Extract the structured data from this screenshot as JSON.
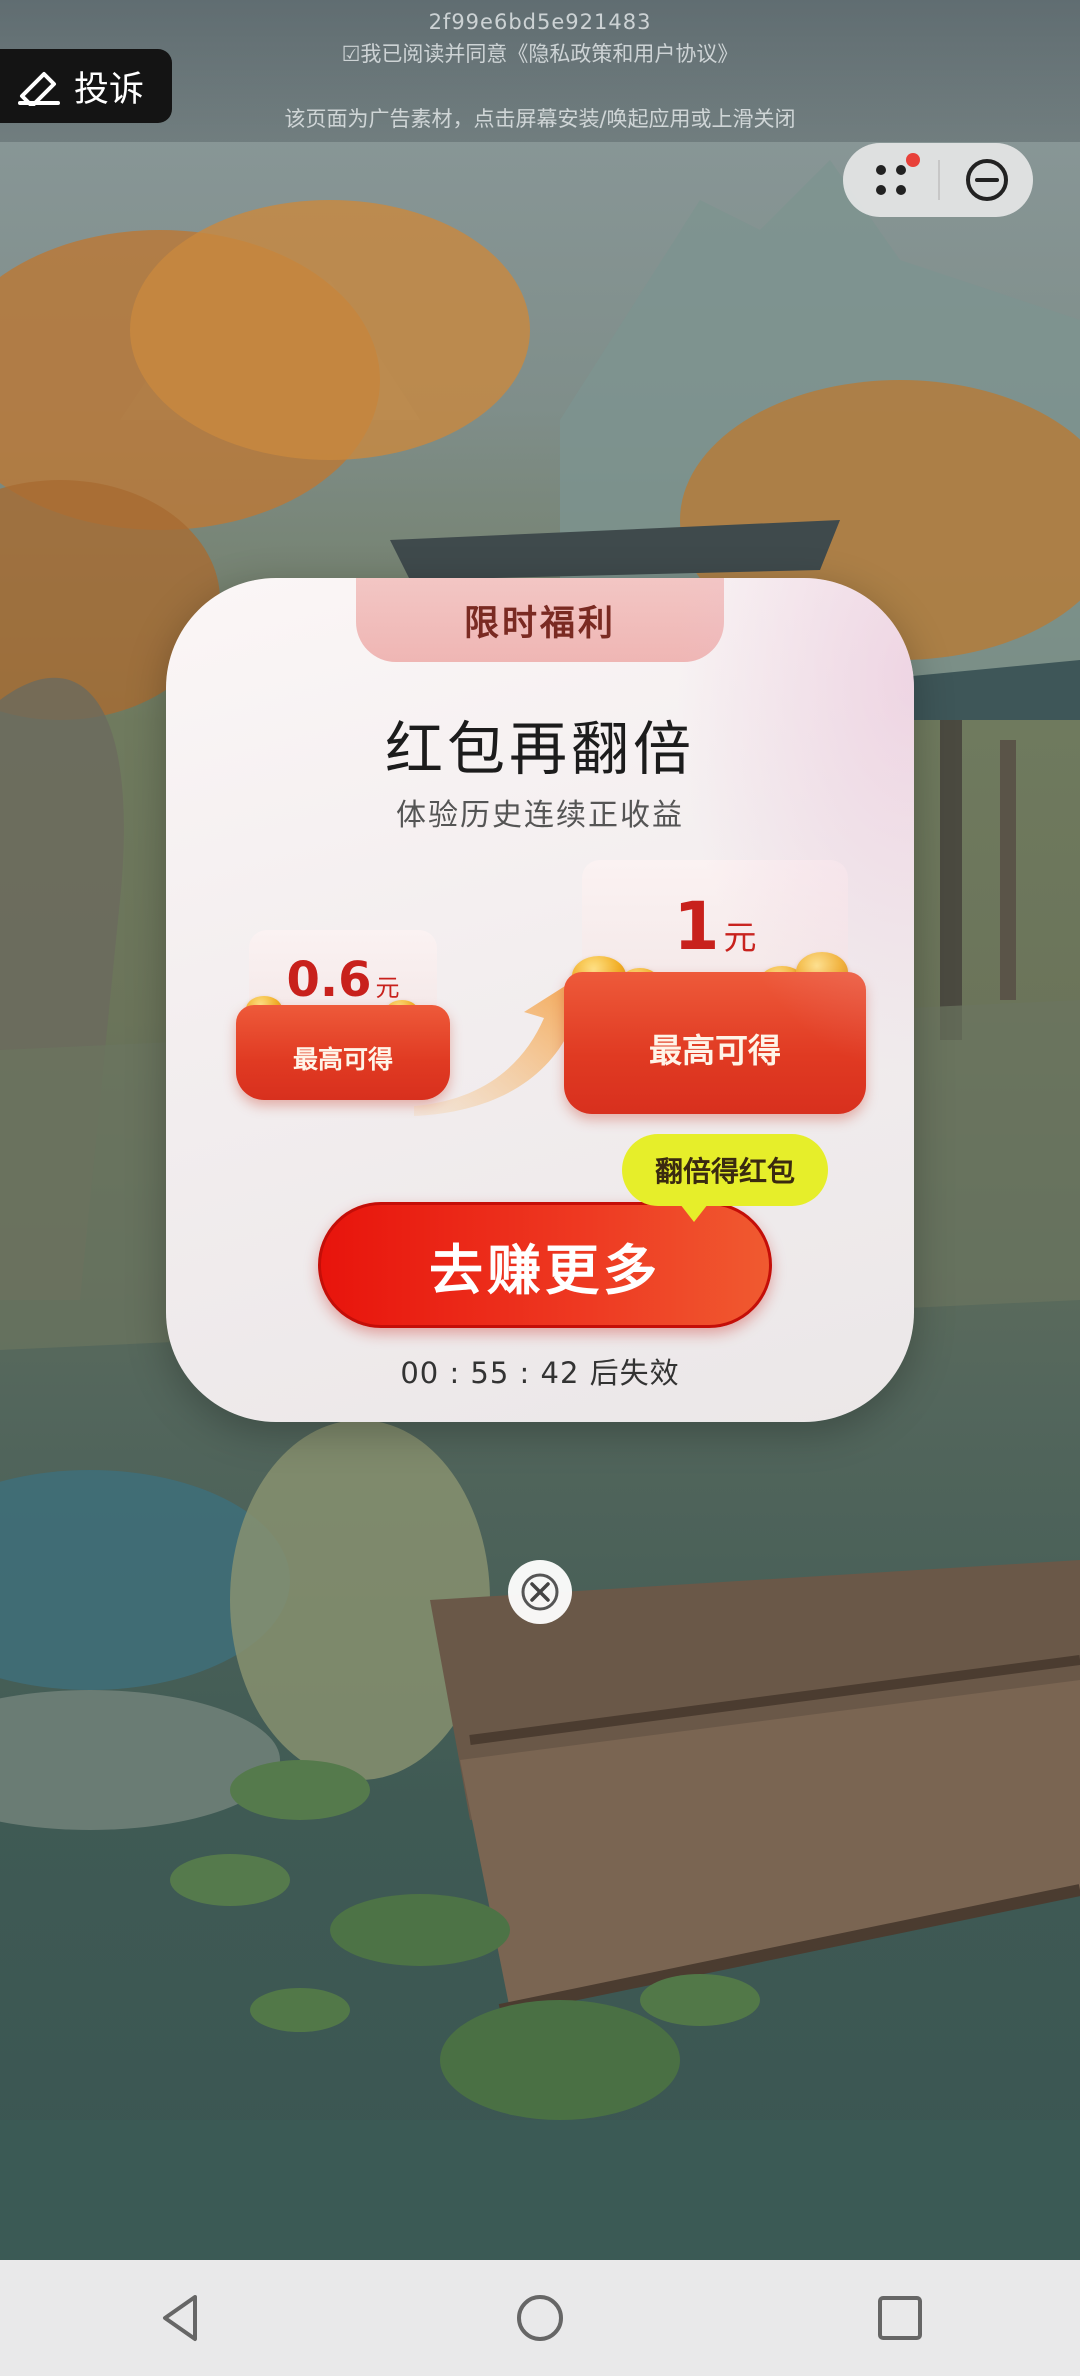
{
  "ad": {
    "id_text": "2f99e6bd5e921483",
    "agreement_text": "☑我已阅读并同意《隐私政策和用户协议》",
    "notice_text": "该页面为广告素材，点击屏幕安装/唤起应用或上滑关闭",
    "complaint_label": "投诉"
  },
  "capsule": {
    "more_icon": "dots-grid-icon",
    "close_icon": "minus-circle-icon",
    "badge_color": "#e8413a"
  },
  "popup": {
    "tab_label": "限时福利",
    "title": "红包再翻倍",
    "subtitle": "体验历史连续正收益",
    "left_envelope": {
      "amount": "0.6",
      "unit": "元",
      "label": "最高可得"
    },
    "right_envelope": {
      "amount": "1",
      "unit": "元",
      "label": "最高可得"
    },
    "tooltip": "翻倍得红包",
    "cta_label": "去赚更多",
    "countdown": "00 : 55 : 42 后失效",
    "cta_color": "#e8140c",
    "tooltip_color": "#e6ee2a"
  },
  "navigation": {
    "back_icon": "back-triangle-icon",
    "home_icon": "home-circle-icon",
    "recents_icon": "recents-square-icon"
  }
}
